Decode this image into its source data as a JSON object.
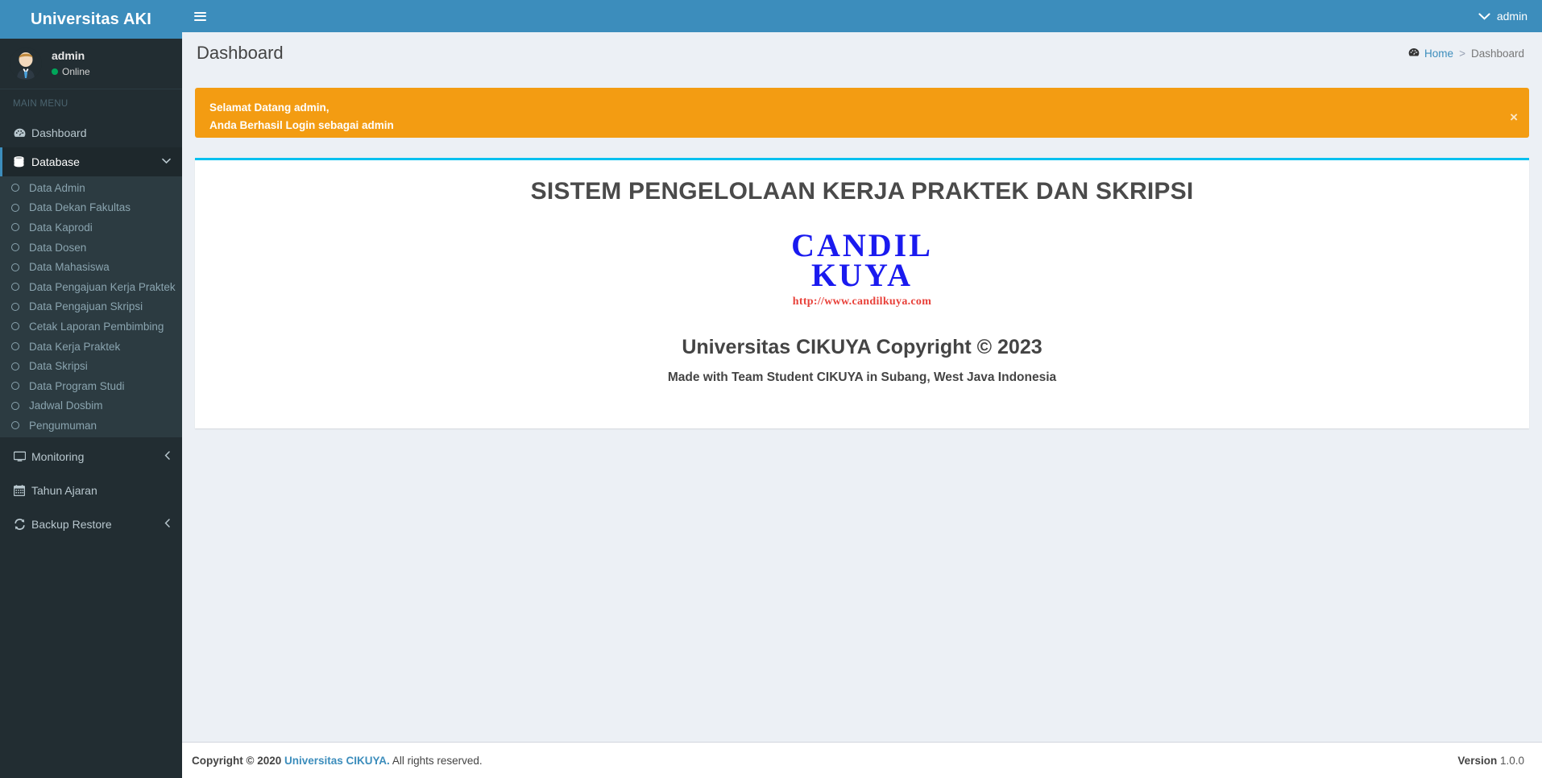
{
  "brand": {
    "title": "Universitas AKI"
  },
  "user_panel": {
    "name": "admin",
    "status": "Online",
    "avatar_icon": "user-avatar-icon"
  },
  "sidebar": {
    "menu_header": "MAIN MENU",
    "items": [
      {
        "label": "Dashboard",
        "icon": "tachometer-icon",
        "active": false,
        "caret": ""
      },
      {
        "label": "Database",
        "icon": "database-icon",
        "active": true,
        "caret": "⌄"
      }
    ],
    "submenu": [
      {
        "label": "Data Admin",
        "icon": "circle-o-icon"
      },
      {
        "label": "Data Dekan Fakultas",
        "icon": "circle-o-icon"
      },
      {
        "label": "Data Kaprodi",
        "icon": "circle-o-icon"
      },
      {
        "label": "Data Dosen",
        "icon": "circle-o-icon"
      },
      {
        "label": "Data Mahasiswa",
        "icon": "circle-o-icon"
      },
      {
        "label": "Data Pengajuan Kerja Praktek",
        "icon": "circle-o-icon"
      },
      {
        "label": "Data Pengajuan Skripsi",
        "icon": "circle-o-icon"
      },
      {
        "label": "Cetak Laporan Pembimbing",
        "icon": "circle-o-icon"
      },
      {
        "label": "Data Kerja Praktek",
        "icon": "circle-o-icon"
      },
      {
        "label": "Data Skripsi",
        "icon": "circle-o-icon"
      },
      {
        "label": "Data Program Studi",
        "icon": "circle-o-icon"
      },
      {
        "label": "Jadwal Dosbim",
        "icon": "circle-o-icon"
      },
      {
        "label": "Pengumuman",
        "icon": "circle-o-icon"
      }
    ],
    "bottom_items": [
      {
        "label": "Monitoring",
        "icon": "desktop-icon",
        "caret": "‹"
      },
      {
        "label": "Tahun Ajaran",
        "icon": "calendar-icon",
        "caret": ""
      },
      {
        "label": "Backup Restore",
        "icon": "refresh-icon",
        "caret": "‹"
      }
    ]
  },
  "header": {
    "toggle_icon": "hamburger-icon",
    "user_label": "admin",
    "user_caret_icon": "chevron-down-icon"
  },
  "content_header": {
    "title": "Dashboard",
    "breadcrumb": {
      "home_icon": "tachometer-icon",
      "home_label": "Home",
      "separator": ">",
      "current": "Dashboard"
    }
  },
  "alert": {
    "line1": "Selamat Datang admin,",
    "line2": "Anda Berhasil Login sebagai admin",
    "close_label": "×",
    "close_icon": "close-icon",
    "color": "#f39c12"
  },
  "card": {
    "accent_color": "#00c0ef",
    "system_title": "SISTEM PENGELOLAAN KERJA PRAKTEK DAN SKRIPSI",
    "logo": {
      "line1": "CANDIL",
      "line2": "KUYA",
      "url": "http://www.candilkuya.com",
      "text_color": "#1a1aef",
      "url_color": "#e8413a"
    },
    "copyright_main": "Universitas CIKUYA Copyright © 2023",
    "copyright_sub": "Made with Team Student CIKUYA in Subang, West Java Indonesia"
  },
  "footer": {
    "copyright_prefix": "Copyright © 2020",
    "link_label": "Universitas CIKUYA.",
    "rights": " All rights reserved.",
    "version_label": "Version",
    "version_value": "1.0.0"
  }
}
